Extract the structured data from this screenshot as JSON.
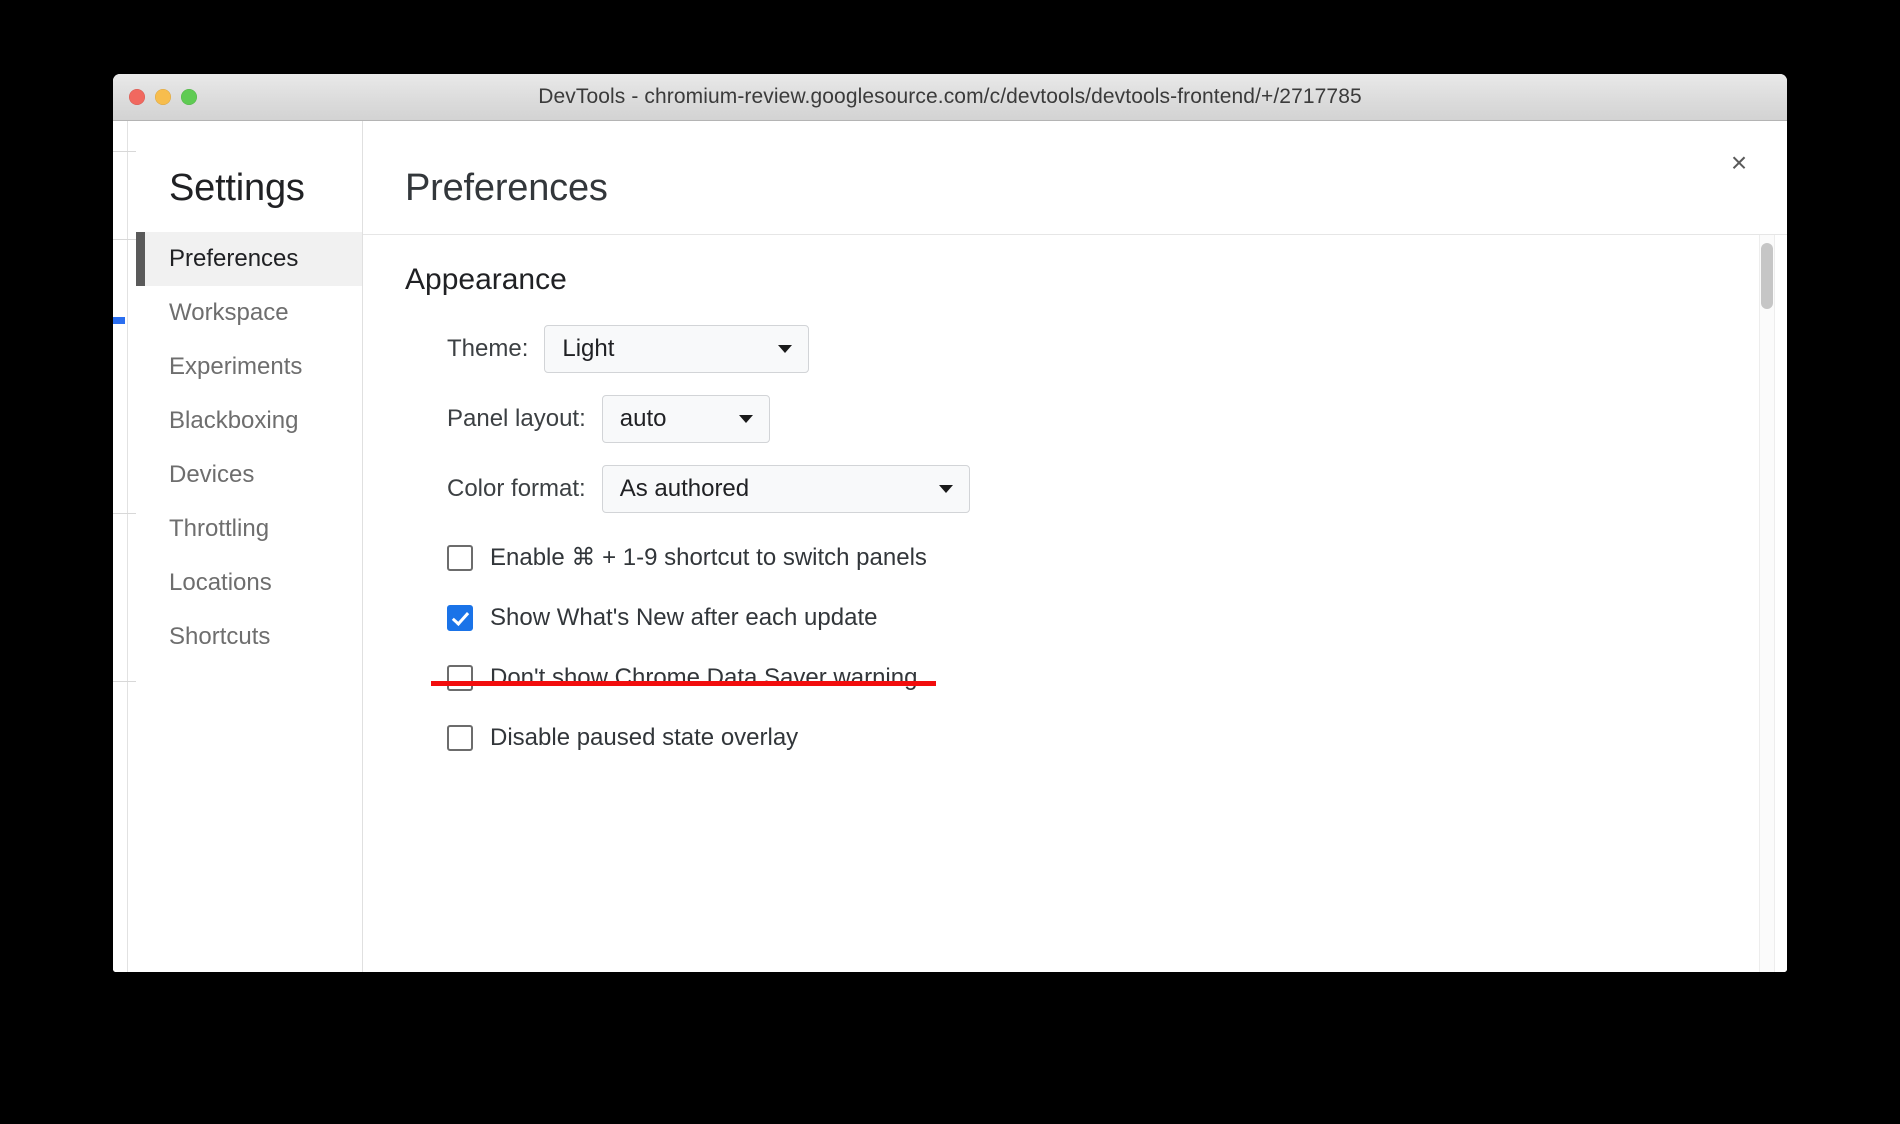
{
  "window": {
    "title": "DevTools - chromium-review.googlesource.com/c/devtools/devtools-frontend/+/2717785",
    "traffic_lights": {
      "close_color": "#f1685f",
      "minimize_color": "#f7bd4d",
      "maximize_color": "#5fcb53"
    }
  },
  "settings_dialog": {
    "close_label": "×",
    "sidebar": {
      "title": "Settings",
      "items": [
        {
          "label": "Preferences",
          "selected": true
        },
        {
          "label": "Workspace",
          "selected": false
        },
        {
          "label": "Experiments",
          "selected": false
        },
        {
          "label": "Blackboxing",
          "selected": false
        },
        {
          "label": "Devices",
          "selected": false
        },
        {
          "label": "Throttling",
          "selected": false
        },
        {
          "label": "Locations",
          "selected": false
        },
        {
          "label": "Shortcuts",
          "selected": false
        }
      ]
    },
    "main": {
      "title": "Preferences",
      "section_title": "Appearance",
      "selects": [
        {
          "label": "Theme:",
          "value": "Light"
        },
        {
          "label": "Panel layout:",
          "value": "auto"
        },
        {
          "label": "Color format:",
          "value": "As authored"
        }
      ],
      "checkboxes": [
        {
          "label": "Enable ⌘ + 1-9 shortcut to switch panels",
          "checked": false,
          "struck": false
        },
        {
          "label": "Show What's New after each update",
          "checked": true,
          "struck": false
        },
        {
          "label": "Don't show Chrome Data Saver warning",
          "checked": false,
          "struck": true
        },
        {
          "label": "Disable paused state overlay",
          "checked": false,
          "struck": false
        }
      ]
    }
  },
  "annotation": {
    "strike_color": "#f20d0d"
  },
  "colors": {
    "accent": "#1a73e8",
    "selected_nav_bg": "#f1f1f1",
    "selected_nav_bar": "#5a5a5a"
  }
}
